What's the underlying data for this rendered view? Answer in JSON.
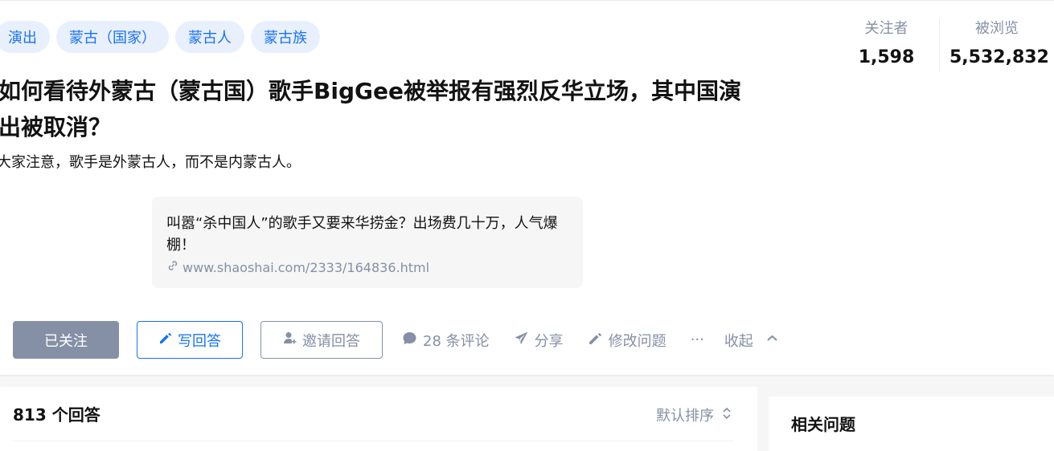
{
  "topics": [
    "演出",
    "蒙古（国家）",
    "蒙古人",
    "蒙古族"
  ],
  "question": {
    "title": "如何看待外蒙古（蒙古国）歌手BigGee被举报有强烈反华立场，其中国演出被取消？",
    "detail": "大家注意，歌手是外蒙古人，而不是内蒙古人。"
  },
  "link_card": {
    "title": "叫嚣“杀中国人”的歌手又要来华捞金？出场费几十万，人气爆棚！",
    "url": "www.shaoshai.com/2333/164836.html",
    "icon": "link-icon"
  },
  "stats": {
    "followers_label": "关注者",
    "followers_value": "1,598",
    "views_label": "被浏览",
    "views_value": "5,532,832"
  },
  "actions": {
    "followed": "已关注",
    "write_answer": "写回答",
    "invite_answer": "邀请回答",
    "comments": "28 条评论",
    "share": "分享",
    "edit_question": "修改问题",
    "more": "···",
    "collapse": "收起"
  },
  "answers": {
    "count": "813 个回答",
    "sort": "默认排序"
  },
  "related": {
    "title": "相关问题"
  },
  "colors": {
    "brand_blue": "#1772f6",
    "gray": "#8590a6",
    "tag_bg": "#e9f0fd"
  }
}
